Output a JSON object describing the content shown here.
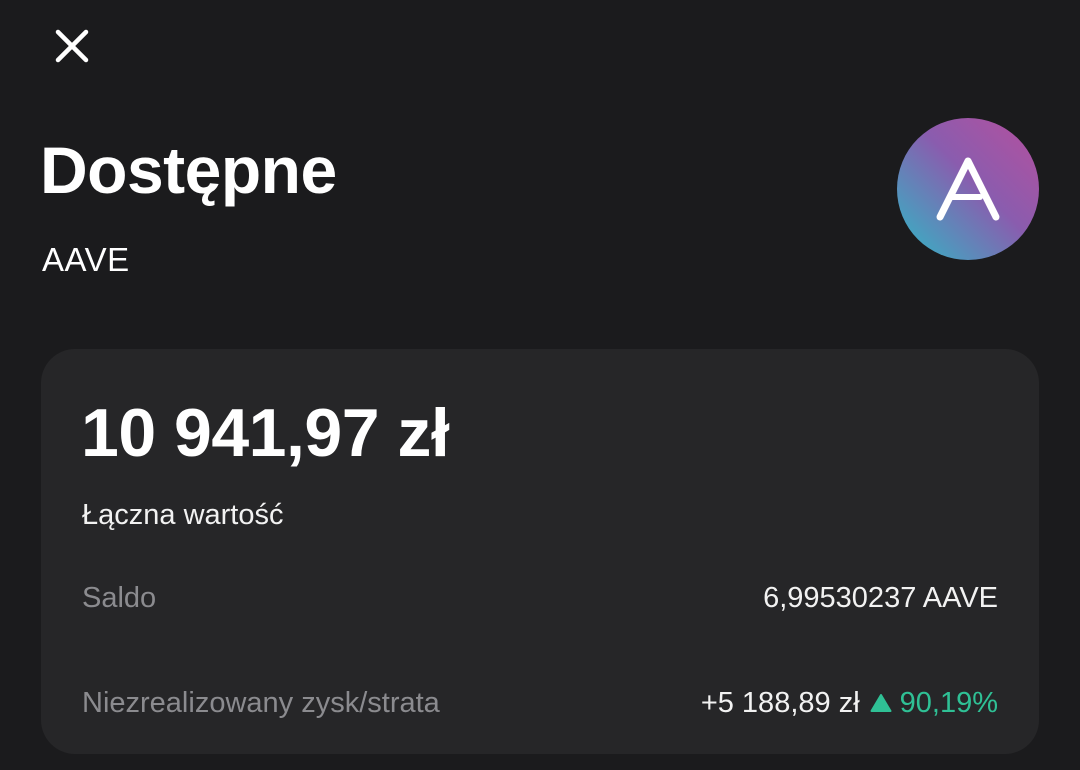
{
  "header": {
    "close_icon": "close-icon",
    "title": "Dostępne",
    "asset_symbol": "AAVE",
    "coin_logo": "aave-logo-icon",
    "coin_logo_letter": "A"
  },
  "summary": {
    "total_value": "10 941,97 zł",
    "total_label": "Łączna wartość",
    "balance_label": "Saldo",
    "balance_value": "6,99530237 AAVE",
    "pnl_label": "Niezrealizowany zysk/strata",
    "pnl_amount": "+5 188,89 zł",
    "pnl_arrow_icon": "triangle-up-icon",
    "pnl_percent": "90,19%"
  },
  "colors": {
    "background": "#1b1b1d",
    "card": "#262628",
    "positive": "#2fc095",
    "muted_text": "#8b8b8f",
    "logo_gradient": [
      "#b6509e",
      "#2ebac6"
    ]
  }
}
